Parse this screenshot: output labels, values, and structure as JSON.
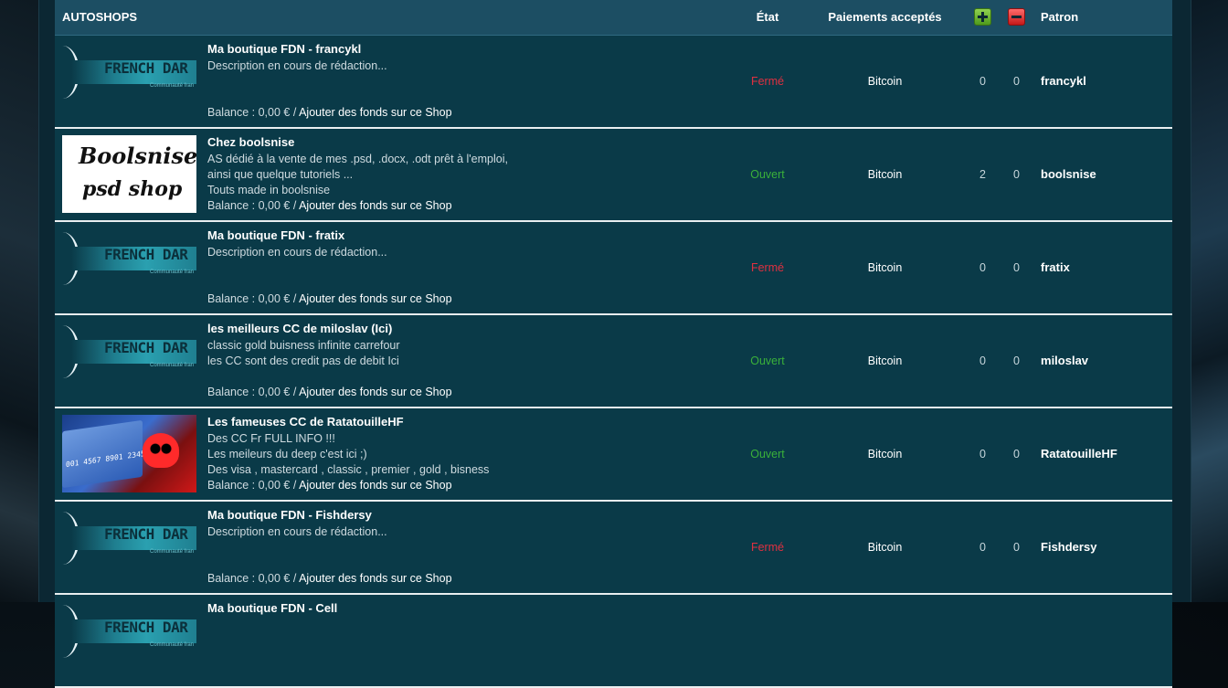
{
  "header": {
    "title": "AUTOSHOPS",
    "state": "État",
    "payments": "Paiements acceptés",
    "patron": "Patron"
  },
  "shops": [
    {
      "logo": "fdn",
      "logo_text": "FRENCH DAR",
      "logo_sub": "Communauté fran",
      "title": "Ma boutique FDN - francykl",
      "desc": [
        "Description en cours de rédaction..."
      ],
      "balance_label": "Balance : 0,00 € / ",
      "add_funds": "Ajouter des fonds sur ce Shop",
      "state": "Fermé",
      "state_color": "#e03040",
      "payment": "Bitcoin",
      "plus": "0",
      "minus": "0",
      "patron": "francykl"
    },
    {
      "logo": "script",
      "logo_line1": "Boolsnise",
      "logo_line2": "psd shop",
      "title": "Chez boolsnise",
      "desc": [
        "AS dédié à la vente de mes .psd, .docx, .odt prêt à l'emploi,",
        "ainsi que quelque tutoriels ...",
        "Touts made in boolsnise"
      ],
      "balance_label": "Balance : 0,00 € / ",
      "add_funds": "Ajouter des fonds sur ce Shop",
      "state": "Ouvert",
      "state_color": "#3ab03a",
      "payment": "Bitcoin",
      "plus": "2",
      "minus": "0",
      "patron": "boolsnise"
    },
    {
      "logo": "fdn",
      "logo_text": "FRENCH DAR",
      "logo_sub": "Communauté fran",
      "title": "Ma boutique FDN - fratix",
      "desc": [
        "Description en cours de rédaction..."
      ],
      "balance_label": "Balance : 0,00 € / ",
      "add_funds": "Ajouter des fonds sur ce Shop",
      "state": "Fermé",
      "state_color": "#e03040",
      "payment": "Bitcoin",
      "plus": "0",
      "minus": "0",
      "patron": "fratix"
    },
    {
      "logo": "fdn",
      "logo_text": "FRENCH DAR",
      "logo_sub": "Communauté fran",
      "title": "les meilleurs CC de miloslav (Ici)",
      "desc": [
        "classic gold buisness infinite carrefour",
        "les CC sont des credit pas de debit Ici"
      ],
      "balance_label": "Balance : 0,00 € / ",
      "add_funds": "Ajouter des fonds sur ce Shop",
      "state": "Ouvert",
      "state_color": "#3ab03a",
      "payment": "Bitcoin",
      "plus": "0",
      "minus": "0",
      "patron": "miloslav"
    },
    {
      "logo": "card",
      "logo_nums": "001 4567 8901 2345",
      "title": "Les fameuses CC de RatatouilleHF",
      "desc": [
        "Des CC Fr FULL INFO !!!",
        "Les meileurs du deep c'est ici ;)",
        "Des visa , mastercard , classic , premier , gold , bisness"
      ],
      "balance_label": "Balance : 0,00 € / ",
      "add_funds": "Ajouter des fonds sur ce Shop",
      "state": "Ouvert",
      "state_color": "#3ab03a",
      "payment": "Bitcoin",
      "plus": "0",
      "minus": "0",
      "patron": "RatatouilleHF"
    },
    {
      "logo": "fdn",
      "logo_text": "FRENCH DAR",
      "logo_sub": "Communauté fran",
      "title": "Ma boutique FDN - Fishdersy",
      "desc": [
        "Description en cours de rédaction..."
      ],
      "balance_label": "Balance : 0,00 € / ",
      "add_funds": "Ajouter des fonds sur ce Shop",
      "state": "Fermé",
      "state_color": "#e03040",
      "payment": "Bitcoin",
      "plus": "0",
      "minus": "0",
      "patron": "Fishdersy"
    },
    {
      "logo": "fdn",
      "logo_text": "FRENCH DAR",
      "logo_sub": "Communauté fran",
      "title": "Ma boutique FDN - Cell",
      "desc": [],
      "balance_label": "",
      "add_funds": "",
      "state": "",
      "state_color": "#e03040",
      "payment": "",
      "plus": "",
      "minus": "",
      "patron": ""
    }
  ]
}
